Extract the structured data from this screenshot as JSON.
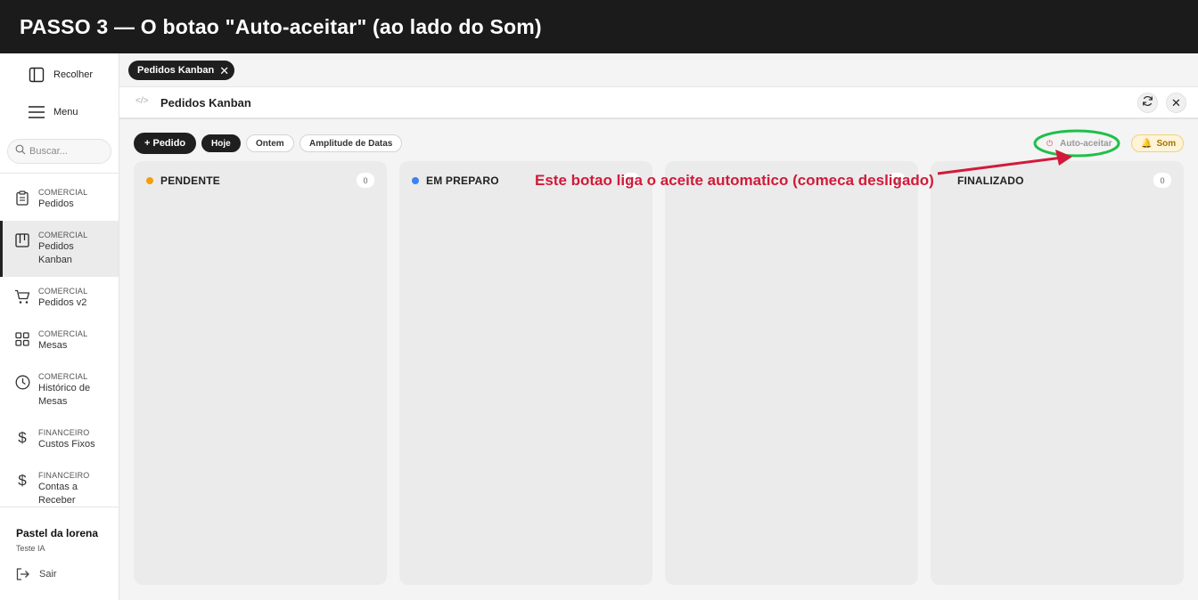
{
  "banner": {
    "title": "PASSO 3  —  O botao \"Auto-aceitar\" (ao lado do Som)"
  },
  "sidebar": {
    "collapse_label": "Recolher",
    "menu_label": "Menu",
    "search_placeholder": "Buscar...",
    "items": [
      {
        "category": "COMERCIAL",
        "label": "Pedidos",
        "icon": "clipboard-icon",
        "active": false
      },
      {
        "category": "COMERCIAL",
        "label": "Pedidos Kanban",
        "icon": "kanban-icon",
        "active": true
      },
      {
        "category": "COMERCIAL",
        "label": "Pedidos v2",
        "icon": "cart-icon",
        "active": false
      },
      {
        "category": "COMERCIAL",
        "label": "Mesas",
        "icon": "grid-icon",
        "active": false
      },
      {
        "category": "COMERCIAL",
        "label": "Histórico de Mesas",
        "icon": "clock-icon",
        "active": false
      },
      {
        "category": "FINANCEIRO",
        "label": "Custos Fixos",
        "icon": "dollar-icon",
        "active": false
      },
      {
        "category": "FINANCEIRO",
        "label": "Contas a Receber",
        "icon": "dollar-icon",
        "active": false
      }
    ],
    "user_name": "Pastel da lorena",
    "user_sub": "Teste IA",
    "logout_label": "Sair"
  },
  "tabs": [
    {
      "label": "Pedidos Kanban"
    }
  ],
  "header": {
    "code_icon": "</>",
    "title": "Pedidos Kanban"
  },
  "toolbar": {
    "new_order_label": "+ Pedido",
    "filters": [
      {
        "label": "Hoje",
        "active": true
      },
      {
        "label": "Ontem",
        "active": false
      },
      {
        "label": "Amplitude de Datas",
        "active": false
      }
    ],
    "auto_accept_label": "Auto-aceitar",
    "sound_label": "Som"
  },
  "columns": [
    {
      "title": "PENDENTE",
      "count": "0",
      "color": "#f59e0b"
    },
    {
      "title": "EM PREPARO",
      "count": "0",
      "color": "#3b82f6"
    },
    {
      "title": "",
      "count": "0",
      "color": ""
    },
    {
      "title": "FINALIZADO",
      "count": "0",
      "color": ""
    }
  ],
  "annotation": {
    "text": "Este botao liga o aceite automatico (comeca desligado)",
    "text_color": "#d11a3a",
    "highlight_color": "#1fbf4a"
  }
}
